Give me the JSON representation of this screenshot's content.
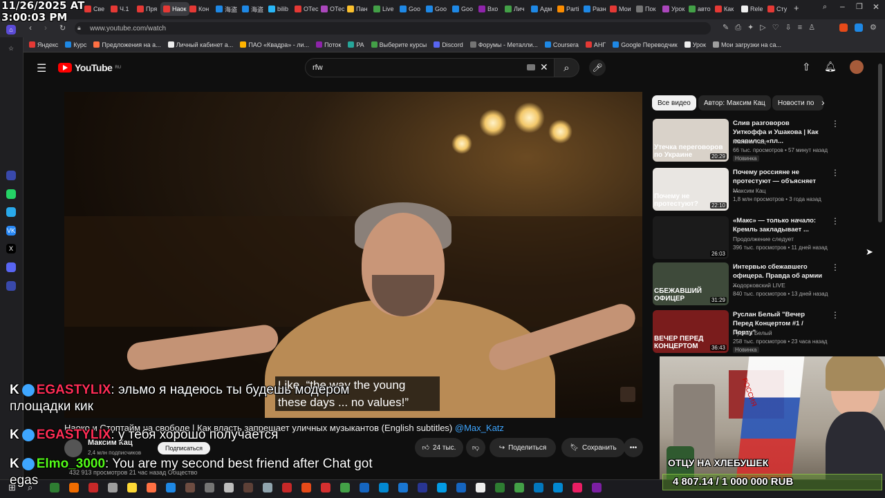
{
  "clock": {
    "date": "11/26/2025 AT",
    "time": "3:00:03 PM"
  },
  "browser": {
    "tabs": [
      {
        "label": "Све",
        "color": "#e53935"
      },
      {
        "label": "Ч.1",
        "color": "#e53935"
      },
      {
        "label": "Пря",
        "color": "#e53935"
      },
      {
        "label": "Наок",
        "color": "#e53935",
        "active": true
      },
      {
        "label": "Кон",
        "color": "#e53935"
      },
      {
        "label": "海盗",
        "color": "#1e88e5"
      },
      {
        "label": "海盗",
        "color": "#1e88e5"
      },
      {
        "label": "bilib",
        "color": "#29b6f6"
      },
      {
        "label": "ОТес",
        "color": "#e53935"
      },
      {
        "label": "ОТес",
        "color": "#ab47bc"
      },
      {
        "label": "Пан",
        "color": "#fbc02d"
      },
      {
        "label": "Live",
        "color": "#43a047"
      },
      {
        "label": "Goo",
        "color": "#1e88e5"
      },
      {
        "label": "Goo",
        "color": "#1e88e5"
      },
      {
        "label": "Goo",
        "color": "#1e88e5"
      },
      {
        "label": "Вхо",
        "color": "#8e24aa"
      },
      {
        "label": "Лич",
        "color": "#43a047"
      },
      {
        "label": "Адм",
        "color": "#1e88e5"
      },
      {
        "label": "Parti",
        "color": "#fb8c00"
      },
      {
        "label": "Разн",
        "color": "#1e88e5"
      },
      {
        "label": "Мои",
        "color": "#e53935"
      },
      {
        "label": "Пок",
        "color": "#757575"
      },
      {
        "label": "Урок",
        "color": "#ab47bc"
      },
      {
        "label": "авто",
        "color": "#43a047"
      },
      {
        "label": "Как",
        "color": "#e53935"
      },
      {
        "label": "Rele",
        "color": "#eeeeee"
      },
      {
        "label": "Сту",
        "color": "#e53935"
      }
    ],
    "url": "www.youtube.com/watch",
    "bookmarks": [
      "Яндекс",
      "Курс",
      "Предложения на а...",
      "Личный кабинет а...",
      "ПАО «Квадра» - ли...",
      "Поток",
      "PA",
      "Выберите курсы",
      "Discord",
      "Форумы - Металли...",
      "Coursera",
      "АНГ",
      "Google Переводчик",
      "Урок",
      "Мои загрузки на са..."
    ]
  },
  "youtube": {
    "logo": "YouTube",
    "logo_region": "RU",
    "search_value": "rfw",
    "colors": {
      "brand": "#ff0000",
      "accent": "#3ea6ff"
    }
  },
  "video": {
    "subtitle_line1": "Like, “the way the young",
    "subtitle_line2": "these days ... no values!”",
    "title": "Наоко и Стоптайм на свободе | Как власть запрещает уличных музыкантов (English subtitles)",
    "title_link": "@Max_Katz",
    "channel": "Максим Кац",
    "subscribers": "2,4 млн подписчиков",
    "subscribe_label": "Подписаться",
    "likes": "24 тыс.",
    "share_label": "Поделиться",
    "save_label": "Сохранить",
    "views_line": "432 913 просмотров  21 час назад  Общество"
  },
  "chat": [
    {
      "user": "EGASTYLIX",
      "user_color": "#ff2d55",
      "text": "эльмо я надеюсь ты будешь модером площадки кик"
    },
    {
      "user": "EGASTYLIX",
      "user_color": "#ff2d55",
      "text": "у тебя хорошо получается"
    },
    {
      "user": "Elmo_3000",
      "user_color": "#53fc18",
      "text": "You are my second best friend after Chat got egas"
    }
  ],
  "chips": [
    "Все видео",
    "Автор: Максим Кац",
    "Новости по"
  ],
  "recommendations": [
    {
      "title": "Слив разговоров Уиткоффа и Ушакова | Как появился «пл...",
      "channel": "Максим Кац",
      "meta": "66 тыс. просмотров • 57 минут назад",
      "tag": "Новинка",
      "duration": "20:29",
      "thumb_caption": "Утечка переговоров по Украине",
      "thumb_color": "#d9d2c9"
    },
    {
      "title": "Почему россияне не протестуют — объясняет ...",
      "channel": "Максим Кац",
      "meta": "1,8 млн просмотров • 3 года назад",
      "tag": "",
      "duration": "22:10",
      "thumb_caption": "Почему не протестуют?",
      "thumb_color": "#e9e6e2"
    },
    {
      "title": "«Макс» — только начало: Кремль закладывает ...",
      "channel": "Продолжение следует",
      "meta": "396 тыс. просмотров • 11 дней назад",
      "tag": "",
      "duration": "26:03",
      "thumb_caption": "",
      "thumb_color": "#1b1b1b"
    },
    {
      "title": "Интервью сбежавшего офицера. Правда об армии ...",
      "channel": "Ходорковский LIVE",
      "meta": "840 тыс. просмотров • 13 дней назад",
      "tag": "",
      "duration": "31:29",
      "thumb_caption": "СБЕЖАВШИЙ ОФИЦЕР",
      "thumb_color": "#3e4a3a"
    },
    {
      "title": "Руслан Белый \"Вечер Перед Концертом #1 / Порту\"",
      "channel": "Руслан Белый",
      "meta": "258 тыс. просмотров • 23 часа назад",
      "tag": "Новинка",
      "duration": "36:43",
      "thumb_caption": "ВЕЧЕР ПЕРЕД КОНЦЕРТОМ",
      "thumb_color": "#7a1c1c"
    }
  ],
  "webcam": {
    "caption": "ОТЦУ НА ХЛЕБУШЕК",
    "donation": "4 807.14 / 1 000 000 RUB",
    "flag_text": "РОССИЯ"
  }
}
